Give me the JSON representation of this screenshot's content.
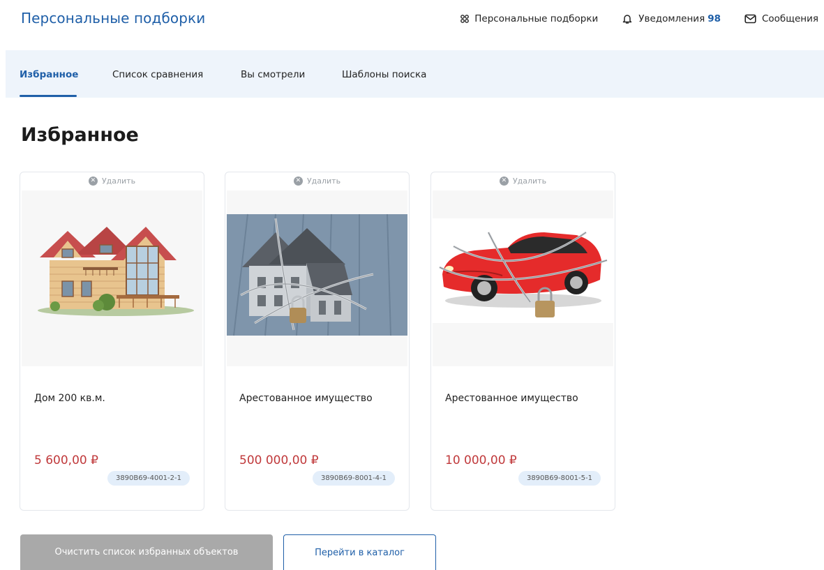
{
  "header": {
    "brand": "Персональные подборки",
    "nav": [
      {
        "label": "Персональные подборки",
        "icon": "grid-dots-icon"
      },
      {
        "label": "Уведомления",
        "count": "98",
        "icon": "bell-icon"
      },
      {
        "label": "Сообщения",
        "icon": "mail-icon"
      }
    ]
  },
  "tabs": [
    {
      "label": "Избранное",
      "active": true
    },
    {
      "label": "Список сравнения",
      "active": false
    },
    {
      "label": "Вы смотрели",
      "active": false
    },
    {
      "label": "Шаблоны поиска",
      "active": false
    }
  ],
  "page": {
    "title": "Избранное"
  },
  "cards": [
    {
      "remove_label": "Удалить",
      "title": "Дом 200 кв.м.",
      "price": "5 600,00 ₽",
      "code": "3890B69-4001-2-1",
      "image": "house-image"
    },
    {
      "remove_label": "Удалить",
      "title": "Арестованное имущество",
      "price": "500 000,00 ₽",
      "code": "3890B69-8001-4-1",
      "image": "chained-house-image"
    },
    {
      "remove_label": "Удалить",
      "title": "Арестованное имущество",
      "price": "10 000,00 ₽",
      "code": "3890B69-8001-5-1",
      "image": "chained-car-image"
    }
  ],
  "actions": {
    "clear_label": "Очистить список избранных объектов",
    "catalog_label": "Перейти в каталог"
  },
  "colors": {
    "accent": "#1f5fa8",
    "price": "#c0393b",
    "tab_bg": "#eef4fb",
    "code_bg": "#e3eefa",
    "clear_btn": "#a9a9a9"
  }
}
